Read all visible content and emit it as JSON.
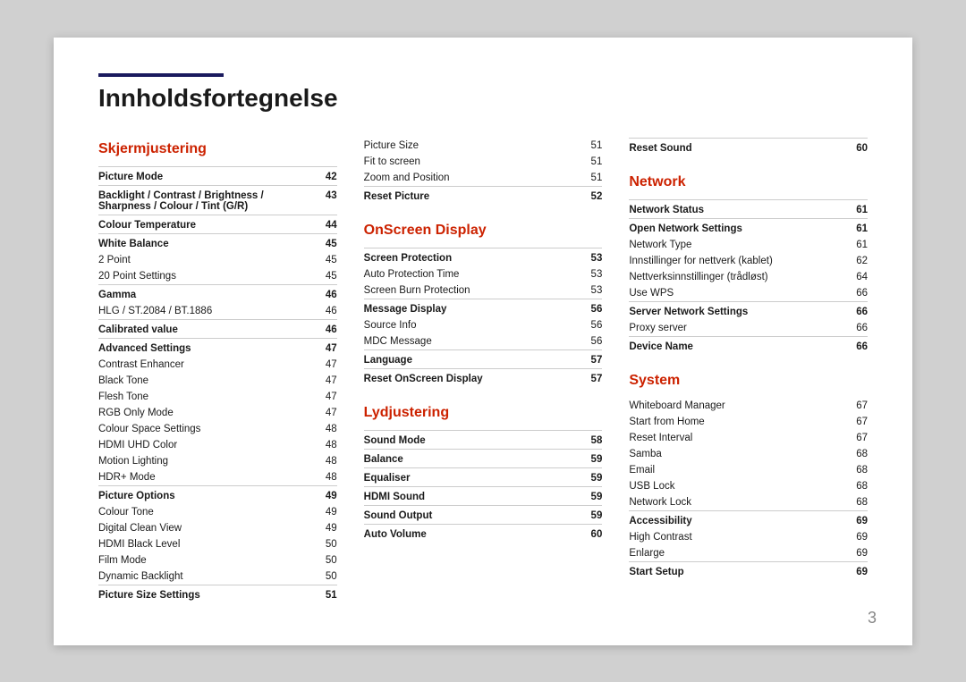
{
  "page": {
    "title": "Innholdsfortegnelse",
    "page_number": "3"
  },
  "col1": {
    "section_title": "Skjermjustering",
    "items": [
      {
        "label": "Picture Mode",
        "page": "42",
        "bold": true,
        "border": true
      },
      {
        "label": "Backlight / Contrast / Brightness / Sharpness / Colour / Tint (G/R)",
        "page": "43",
        "bold": true,
        "border": true
      },
      {
        "label": "Colour Temperature",
        "page": "44",
        "bold": true,
        "border": true
      },
      {
        "label": "White Balance",
        "page": "45",
        "bold": true,
        "border": true
      },
      {
        "label": "2 Point",
        "page": "45",
        "bold": false,
        "border": false
      },
      {
        "label": "20 Point Settings",
        "page": "45",
        "bold": false,
        "border": false
      },
      {
        "label": "Gamma",
        "page": "46",
        "bold": true,
        "border": true
      },
      {
        "label": "HLG / ST.2084 / BT.1886",
        "page": "46",
        "bold": false,
        "border": false
      },
      {
        "label": "Calibrated value",
        "page": "46",
        "bold": true,
        "border": true
      },
      {
        "label": "Advanced Settings",
        "page": "47",
        "bold": true,
        "border": true
      },
      {
        "label": "Contrast Enhancer",
        "page": "47",
        "bold": false,
        "border": false
      },
      {
        "label": "Black Tone",
        "page": "47",
        "bold": false,
        "border": false
      },
      {
        "label": "Flesh Tone",
        "page": "47",
        "bold": false,
        "border": false
      },
      {
        "label": "RGB Only Mode",
        "page": "47",
        "bold": false,
        "border": false
      },
      {
        "label": "Colour Space Settings",
        "page": "48",
        "bold": false,
        "border": false
      },
      {
        "label": "HDMI UHD Color",
        "page": "48",
        "bold": false,
        "border": false
      },
      {
        "label": "Motion Lighting",
        "page": "48",
        "bold": false,
        "border": false
      },
      {
        "label": "HDR+ Mode",
        "page": "48",
        "bold": false,
        "border": false
      },
      {
        "label": "Picture Options",
        "page": "49",
        "bold": true,
        "border": true
      },
      {
        "label": "Colour Tone",
        "page": "49",
        "bold": false,
        "border": false
      },
      {
        "label": "Digital Clean View",
        "page": "49",
        "bold": false,
        "border": false
      },
      {
        "label": "HDMI Black Level",
        "page": "50",
        "bold": false,
        "border": false
      },
      {
        "label": "Film Mode",
        "page": "50",
        "bold": false,
        "border": false
      },
      {
        "label": "Dynamic Backlight",
        "page": "50",
        "bold": false,
        "border": false
      },
      {
        "label": "Picture Size Settings",
        "page": "51",
        "bold": true,
        "border": true
      }
    ]
  },
  "col2": {
    "section_title_pic": "",
    "items_top": [
      {
        "label": "Picture Size",
        "page": "51",
        "bold": false,
        "border": false
      },
      {
        "label": "Fit to screen",
        "page": "51",
        "bold": false,
        "border": false
      },
      {
        "label": "Zoom and Position",
        "page": "51",
        "bold": false,
        "border": false
      },
      {
        "label": "Reset Picture",
        "page": "52",
        "bold": true,
        "border": true
      }
    ],
    "section_title": "OnScreen Display",
    "items": [
      {
        "label": "Screen Protection",
        "page": "53",
        "bold": true,
        "border": true
      },
      {
        "label": "Auto Protection Time",
        "page": "53",
        "bold": false,
        "border": false
      },
      {
        "label": "Screen Burn Protection",
        "page": "53",
        "bold": false,
        "border": false
      },
      {
        "label": "Message Display",
        "page": "56",
        "bold": true,
        "border": true
      },
      {
        "label": "Source Info",
        "page": "56",
        "bold": false,
        "border": false
      },
      {
        "label": "MDC Message",
        "page": "56",
        "bold": false,
        "border": false
      },
      {
        "label": "Language",
        "page": "57",
        "bold": true,
        "border": true
      },
      {
        "label": "Reset OnScreen Display",
        "page": "57",
        "bold": true,
        "border": true
      }
    ],
    "section_title2": "Lydjustering",
    "items2": [
      {
        "label": "Sound Mode",
        "page": "58",
        "bold": true,
        "border": true
      },
      {
        "label": "Balance",
        "page": "59",
        "bold": true,
        "border": true
      },
      {
        "label": "Equaliser",
        "page": "59",
        "bold": true,
        "border": true
      },
      {
        "label": "HDMI Sound",
        "page": "59",
        "bold": true,
        "border": true
      },
      {
        "label": "Sound Output",
        "page": "59",
        "bold": true,
        "border": true
      },
      {
        "label": "Auto Volume",
        "page": "60",
        "bold": true,
        "border": true
      }
    ]
  },
  "col3": {
    "items_top": [
      {
        "label": "Reset Sound",
        "page": "60",
        "bold": true,
        "border": true
      }
    ],
    "section_title": "Network",
    "items": [
      {
        "label": "Network Status",
        "page": "61",
        "bold": true,
        "border": true
      },
      {
        "label": "Open Network Settings",
        "page": "61",
        "bold": true,
        "border": true
      },
      {
        "label": "Network Type",
        "page": "61",
        "bold": false,
        "border": false
      },
      {
        "label": "Innstillinger for nettverk (kablet)",
        "page": "62",
        "bold": false,
        "border": false
      },
      {
        "label": "Nettverksinnstillinger (trådløst)",
        "page": "64",
        "bold": false,
        "border": false
      },
      {
        "label": "Use WPS",
        "page": "66",
        "bold": false,
        "border": false
      },
      {
        "label": "Server Network Settings",
        "page": "66",
        "bold": true,
        "border": true
      },
      {
        "label": "Proxy server",
        "page": "66",
        "bold": false,
        "border": false
      },
      {
        "label": "Device Name",
        "page": "66",
        "bold": true,
        "border": true
      }
    ],
    "section_title2": "System",
    "items2": [
      {
        "label": "Whiteboard Manager",
        "page": "67",
        "bold": false,
        "border": false
      },
      {
        "label": "Start from Home",
        "page": "67",
        "bold": false,
        "border": false
      },
      {
        "label": "Reset Interval",
        "page": "67",
        "bold": false,
        "border": false
      },
      {
        "label": "Samba",
        "page": "68",
        "bold": false,
        "border": false
      },
      {
        "label": "Email",
        "page": "68",
        "bold": false,
        "border": false
      },
      {
        "label": "USB Lock",
        "page": "68",
        "bold": false,
        "border": false
      },
      {
        "label": "Network Lock",
        "page": "68",
        "bold": false,
        "border": false
      },
      {
        "label": "Accessibility",
        "page": "69",
        "bold": true,
        "border": true
      },
      {
        "label": "High Contrast",
        "page": "69",
        "bold": false,
        "border": false
      },
      {
        "label": "Enlarge",
        "page": "69",
        "bold": false,
        "border": false
      },
      {
        "label": "Start Setup",
        "page": "69",
        "bold": true,
        "border": true
      }
    ]
  }
}
